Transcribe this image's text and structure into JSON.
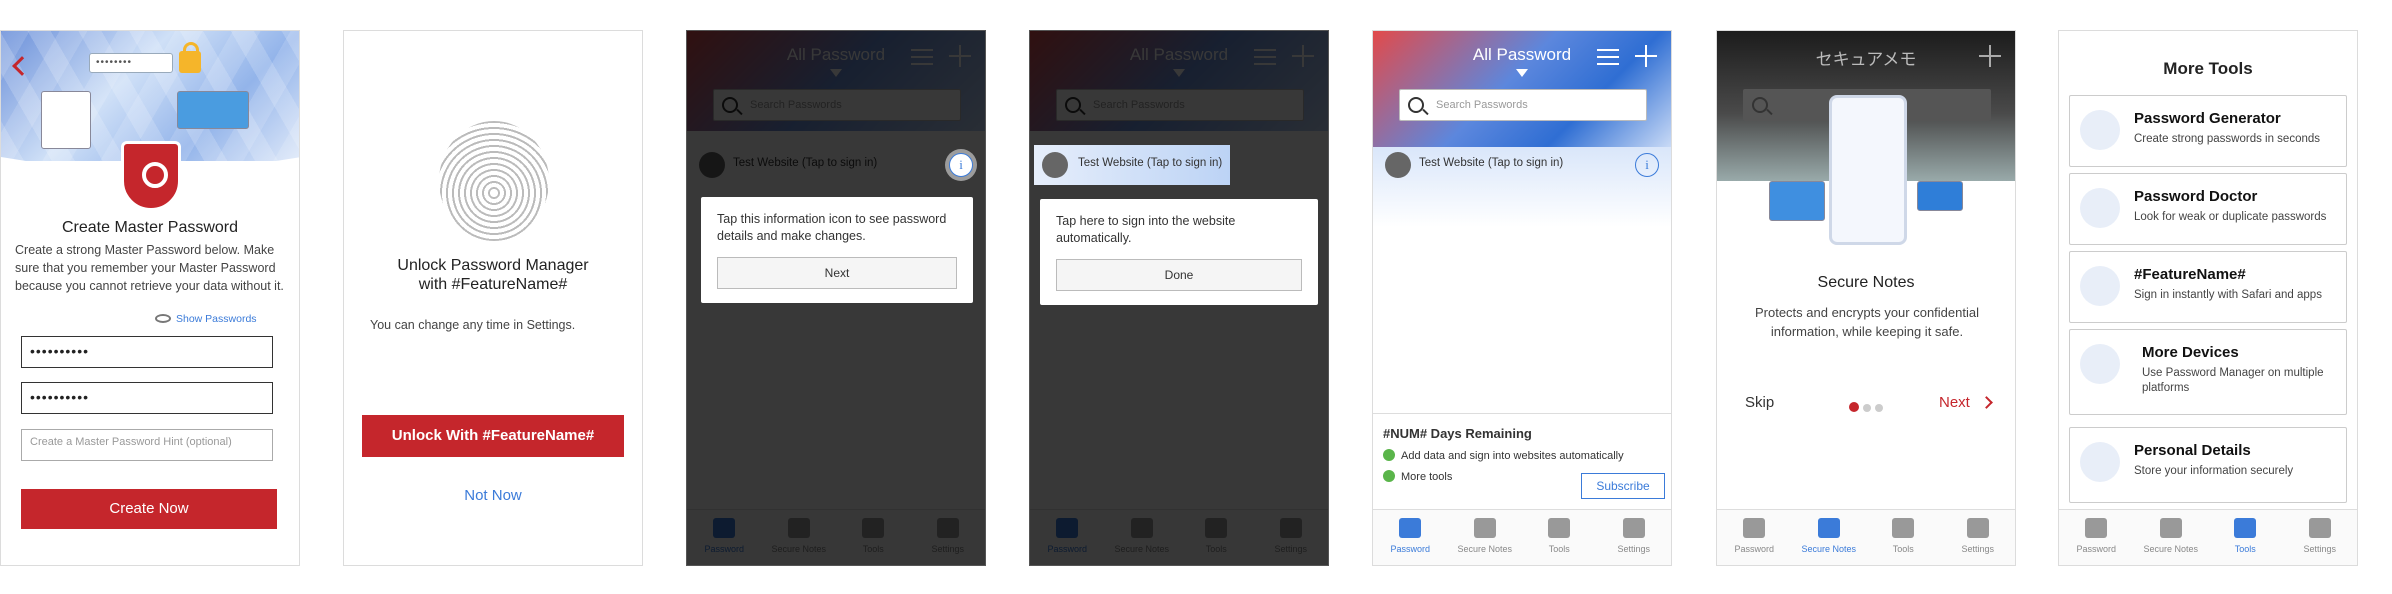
{
  "screen1": {
    "password_mask": "••••••••",
    "title": "Create Master Password",
    "description": "Create a strong Master Password below. Make sure that you remember your Master Password because you cannot retrieve your data without it.",
    "show_passwords": "Show Passwords",
    "field1_value": "••••••••••",
    "field2_value": "••••••••••",
    "hint_placeholder": "Create a Master Password Hint (optional)",
    "create_button": "Create Now"
  },
  "screen2": {
    "title": "Unlock Password Manager with #FeatureName#",
    "subtitle": "You can change any time in Settings.",
    "unlock_button": "Unlock With #FeatureName#",
    "not_now": "Not Now"
  },
  "vault": {
    "title": "All Password",
    "search_placeholder": "Search Passwords",
    "row_label": "Test Website (Tap to sign in)",
    "info_glyph": "i"
  },
  "screen3": {
    "tip_text": "Tap this information icon to see password details and make changes.",
    "tip_button": "Next"
  },
  "screen4": {
    "tip_text": "Tap here to sign into the website automatically.",
    "tip_button": "Done"
  },
  "screen5": {
    "days_remaining": "#NUM# Days Remaining",
    "feature1": "Add data and sign into websites automatically",
    "feature2": "More tools",
    "subscribe": "Subscribe"
  },
  "screen6": {
    "header_title": "セキュアメモ",
    "title": "Secure Notes",
    "description": "Protects and encrypts your confidential information, while keeping it safe.",
    "skip": "Skip",
    "next": "Next"
  },
  "screen7": {
    "title": "More Tools",
    "tools": [
      {
        "title": "Password Generator",
        "desc": "Create strong passwords in seconds"
      },
      {
        "title": "Password Doctor",
        "desc": "Look for weak or duplicate passwords"
      },
      {
        "title": "#FeatureName#",
        "desc": "Sign in instantly with Safari and apps"
      },
      {
        "title": "More Devices",
        "desc": "Use Password Manager on multiple platforms"
      },
      {
        "title": "Personal Details",
        "desc": "Store your information securely"
      }
    ]
  },
  "tabs": {
    "password": "Password",
    "secure_notes": "Secure Notes",
    "tools": "Tools",
    "settings": "Settings"
  },
  "colors": {
    "brand_red": "#c5262c",
    "accent_blue": "#3b7bd9",
    "check_green": "#5ab54a"
  }
}
